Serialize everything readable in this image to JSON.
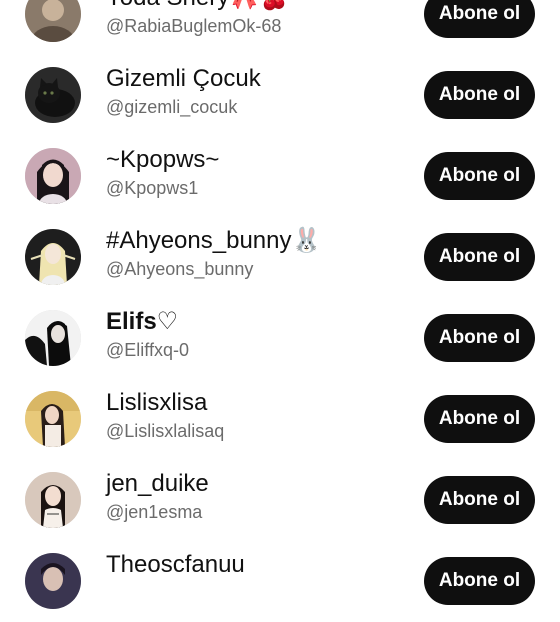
{
  "subscribe_label": "Abone ol",
  "channels": [
    {
      "name": "Yoda Shery🎀🍒",
      "handle": "@RabiaBuglemOk-68",
      "avatar_icon": "avatar-image",
      "avatar_color": "#8a7a6a"
    },
    {
      "name": "Gizemli Çocuk",
      "handle": "@gizemli_cocuk",
      "avatar_icon": "black-cat-avatar",
      "avatar_color": "#1c1c1c"
    },
    {
      "name": "~Kpopws~",
      "handle": "@Kpopws1",
      "avatar_icon": "person-avatar",
      "avatar_color": "#c9a8b4"
    },
    {
      "name": "#Ahyeons_bunny🐰",
      "handle": "@Ahyeons_bunny",
      "avatar_icon": "person-avatar",
      "avatar_color": "#2a2a2a"
    },
    {
      "name": "Elifs♡",
      "handle": "@Eliffxq-0",
      "avatar_icon": "person-avatar",
      "avatar_color": "#111111",
      "bold": true
    },
    {
      "name": "Lislisxlisa",
      "handle": "@Lislisxlalisaq",
      "avatar_icon": "person-avatar",
      "avatar_color": "#e8c97a"
    },
    {
      "name": "jen_duike",
      "handle": "@jen1esma",
      "avatar_icon": "person-avatar",
      "avatar_color": "#d8c8bc"
    },
    {
      "name": "Theoscfanuu",
      "handle": "",
      "avatar_icon": "person-avatar",
      "avatar_color": "#3a3550"
    }
  ]
}
